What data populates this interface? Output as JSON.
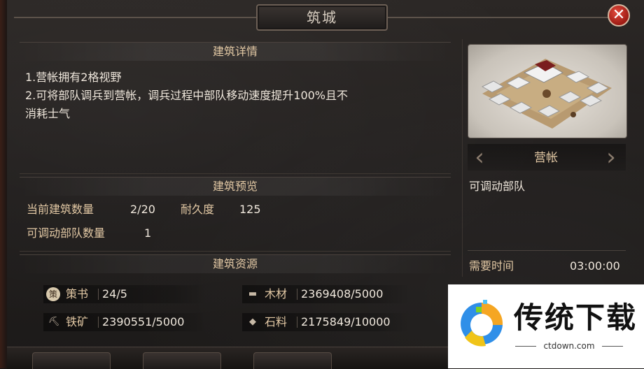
{
  "title": "筑城",
  "close_glyph": "✕",
  "details": {
    "header": "建筑详情",
    "lines": [
      "1.营帐拥有2格视野",
      "2.可将部队调兵到营帐，调兵过程中部队移动速度提升100%且不",
      "消耗士气"
    ]
  },
  "preview": {
    "header": "建筑预览",
    "current_count_label": "当前建筑数量",
    "current_count_value": "2/20",
    "durability_label": "耐久度",
    "durability_value": "125",
    "troops_label": "可调动部队数量",
    "troops_value": "1"
  },
  "resources": {
    "header": "建筑资源",
    "items": [
      {
        "icon": "strategy-book-icon",
        "glyph": "策",
        "name": "策书",
        "value": "24/5"
      },
      {
        "icon": "wood-icon",
        "glyph": "▬",
        "name": "木材",
        "value": "2369408/5000"
      },
      {
        "icon": "iron-ore-icon",
        "glyph": "⛏",
        "name": "铁矿",
        "value": "2390551/5000"
      },
      {
        "icon": "stone-icon",
        "glyph": "◆",
        "name": "石料",
        "value": "2175849/10000"
      }
    ]
  },
  "building": {
    "name": "营帐",
    "description": "可调动部队",
    "time_label": "需要时间",
    "time_value": "03:00:00",
    "prev_arrow": "‹",
    "next_arrow": "›"
  },
  "watermark": {
    "title": "传统下载",
    "url": "ctdown.com"
  },
  "colors": {
    "label_gold": "#e2c8a4",
    "text_light": "#efe7dc",
    "close_red": "#c9281d"
  }
}
